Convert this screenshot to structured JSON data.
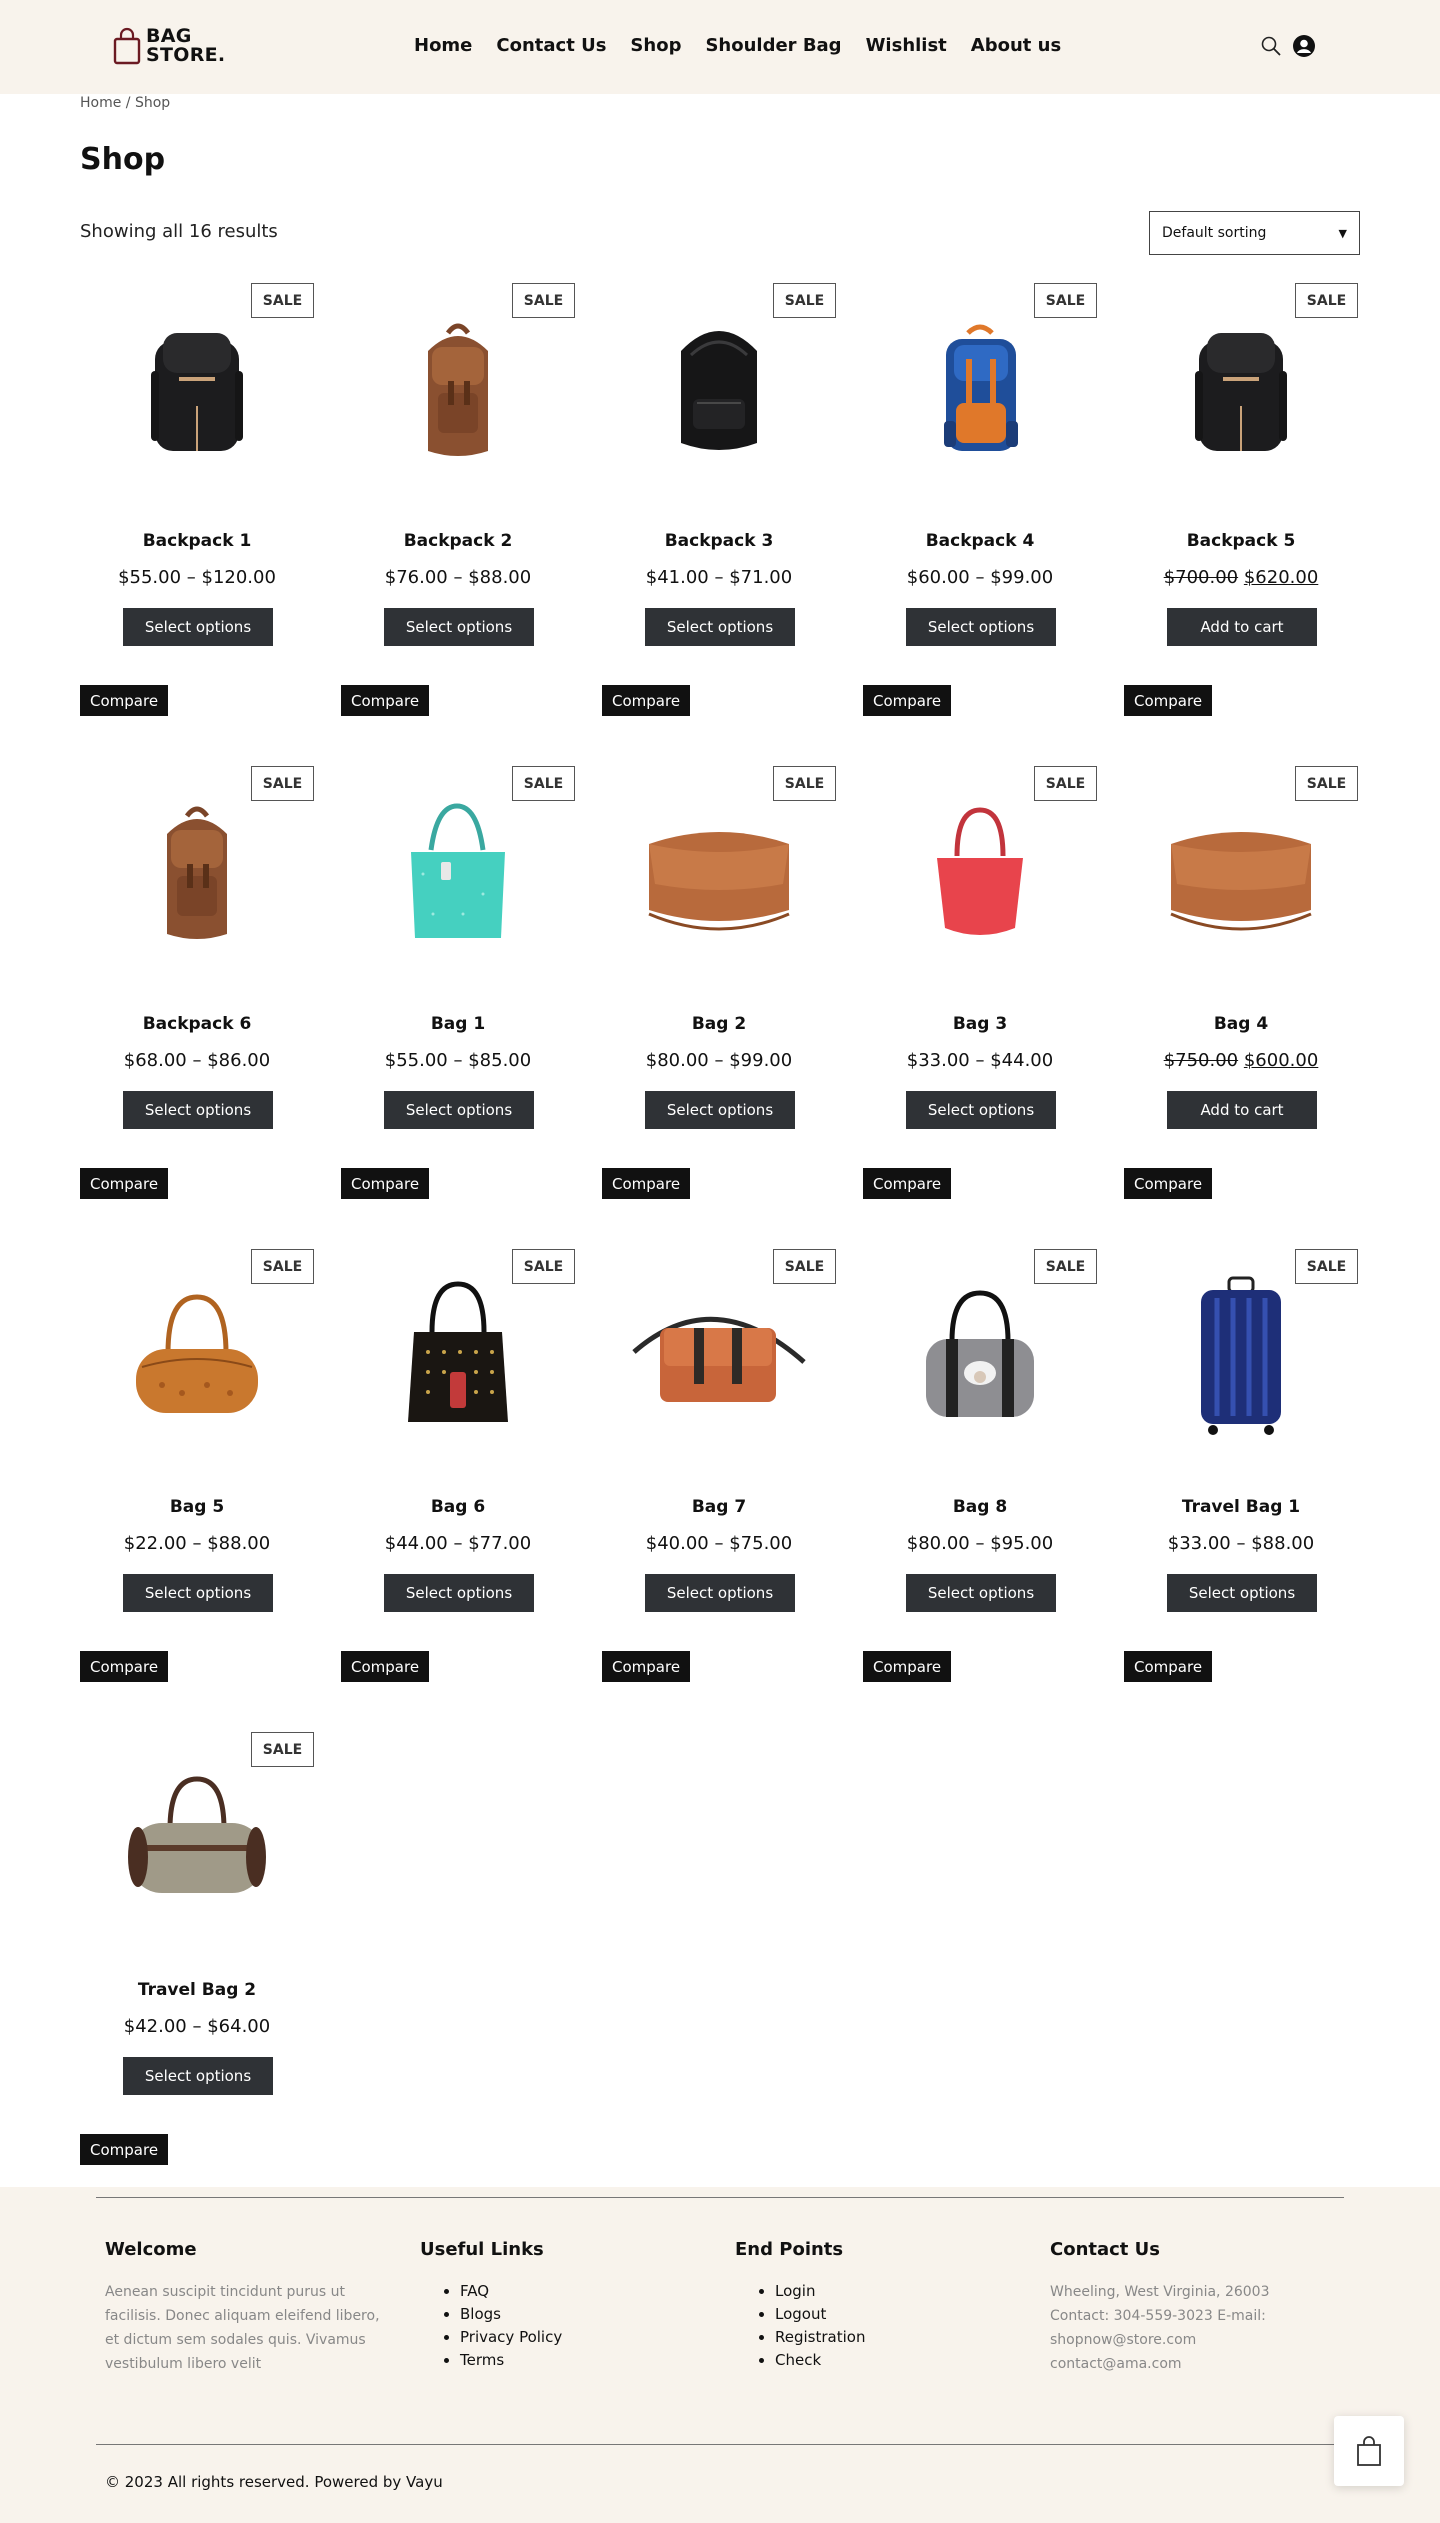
{
  "header": {
    "logo_line1": "BAG",
    "logo_line2": "STORE.",
    "nav": [
      "Home",
      "Contact Us",
      "Shop",
      "Shoulder Bag",
      "Wishlist",
      "About us"
    ]
  },
  "breadcrumb": {
    "home": "Home",
    "separator": " / ",
    "current": "Shop"
  },
  "page_title": "Shop",
  "result_count": "Showing all 16 results",
  "sort": {
    "selected": "Default sorting"
  },
  "sale_label": "SALE",
  "compare_label": "Compare",
  "products": [
    {
      "title": "Backpack 1",
      "price": "$55.00 – $120.00",
      "button": "Select options",
      "image": "black-backpack-icon"
    },
    {
      "title": "Backpack 2",
      "price": "$76.00 – $88.00",
      "button": "Select options",
      "image": "brown-rucksack-icon"
    },
    {
      "title": "Backpack 3",
      "price": "$41.00 – $71.00",
      "button": "Select options",
      "image": "black-leather-backpack-icon"
    },
    {
      "title": "Backpack 4",
      "price": "$60.00 – $99.00",
      "button": "Select options",
      "image": "blue-school-backpack-icon"
    },
    {
      "title": "Backpack 5",
      "price_old": "$700.00",
      "price_new": "$620.00",
      "button": "Add to cart",
      "image": "black-backpack-icon"
    },
    {
      "title": "Backpack 6",
      "price": "$68.00 – $86.00",
      "button": "Select options",
      "image": "brown-rucksack-icon"
    },
    {
      "title": "Bag 1",
      "price": "$55.00 – $85.00",
      "button": "Select options",
      "image": "teal-tote-bag-icon"
    },
    {
      "title": "Bag 2",
      "price": "$80.00 – $99.00",
      "button": "Select options",
      "image": "tan-shoulder-bag-icon"
    },
    {
      "title": "Bag 3",
      "price": "$33.00 – $44.00",
      "button": "Select options",
      "image": "red-handbag-icon"
    },
    {
      "title": "Bag 4",
      "price_old": "$750.00",
      "price_new": "$600.00",
      "button": "Add to cart",
      "image": "tan-shoulder-bag-icon"
    },
    {
      "title": "Bag 5",
      "price": "$22.00 – $88.00",
      "button": "Select options",
      "image": "orange-duffel-icon"
    },
    {
      "title": "Bag 6",
      "price": "$44.00 – $77.00",
      "button": "Select options",
      "image": "black-studded-tote-icon"
    },
    {
      "title": "Bag 7",
      "price": "$40.00 – $75.00",
      "button": "Select options",
      "image": "orange-messenger-bag-icon"
    },
    {
      "title": "Bag 8",
      "price": "$80.00 – $95.00",
      "button": "Select options",
      "image": "grey-sheep-bag-icon"
    },
    {
      "title": "Travel Bag 1",
      "price": "$33.00 – $88.00",
      "button": "Select options",
      "image": "blue-suitcase-icon"
    },
    {
      "title": "Travel Bag 2",
      "price": "$42.00 – $64.00",
      "button": "Select options",
      "image": "canvas-duffel-icon"
    }
  ],
  "footer": {
    "welcome": {
      "title": "Welcome",
      "text": " Aenean suscipit tincidunt purus ut facilisis. Donec aliquam eleifend libero, et dictum sem sodales quis. Vivamus vestibulum libero velit"
    },
    "useful_links": {
      "title": "Useful Links",
      "items": [
        "FAQ",
        "Blogs",
        "Privacy Policy",
        "Terms"
      ]
    },
    "end_points": {
      "title": "End Points",
      "items": [
        "Login",
        "Logout",
        "Registration",
        "Check"
      ]
    },
    "contact": {
      "title": "Contact Us",
      "text": "Wheeling, West Virginia, 26003 Contact: 304-559-3023 E-mail: shopnow@store.com contact@ama.com"
    },
    "copyright": "© 2023 All rights reserved. Powered by Vayu"
  },
  "colors": {
    "header_bg": "#f8f3ec",
    "footer_bg": "#f8f3ec",
    "button_bg": "#2f3236",
    "compare_bg": "#111111"
  }
}
